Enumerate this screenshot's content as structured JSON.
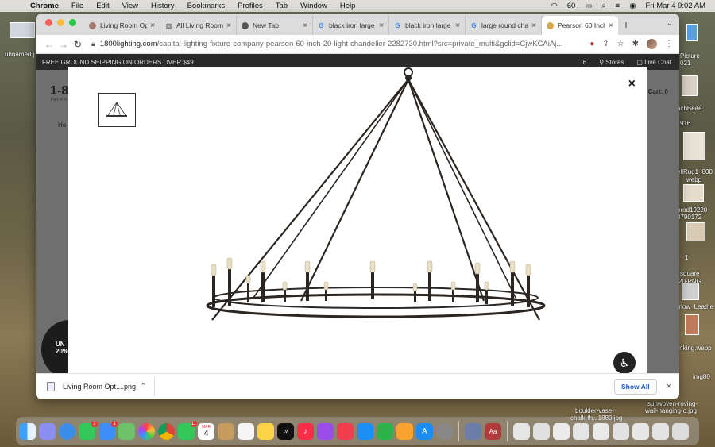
{
  "menubar": {
    "app": "Chrome",
    "items": [
      "File",
      "Edit",
      "View",
      "History",
      "Bookmarks",
      "Profiles",
      "Tab",
      "Window",
      "Help"
    ],
    "battery": "60",
    "clock": "Fri Mar 4  9:02 AM"
  },
  "desktop": {
    "left_label": "unnamed.j",
    "right_items": [
      "Picture",
      "021",
      "acbBeae",
      "916",
      "ellRug1_800",
      "webp",
      "prod19220",
      "8790172",
      "1",
      "square",
      "20-PNG",
      "arlow_Leathe",
      "ranking.webp",
      "img80",
      "boulder-vase-",
      "chalk-th...1880.jpg",
      "sunwoven-roving-",
      "wall-hanging-o.jpg"
    ]
  },
  "tabs": [
    {
      "title": "Living Room Opt",
      "icon": "avatar-favicon"
    },
    {
      "title": "All Living Room",
      "icon": "bookmark-favicon"
    },
    {
      "title": "New Tab",
      "icon": "chrome-favicon"
    },
    {
      "title": "black iron large",
      "icon": "google-favicon"
    },
    {
      "title": "black iron large",
      "icon": "google-favicon"
    },
    {
      "title": "large round cha",
      "icon": "google-favicon"
    },
    {
      "title": "Pearson 60 Inch",
      "icon": "1800lighting-favicon",
      "active": true
    }
  ],
  "address": {
    "host": "1800lighting.com",
    "path": "/capital-lighting-fixture-company-pearson-60-inch-20-light-chandelier-2282730.html?src=private_multi&gclid=CjwKCAiAj..."
  },
  "page": {
    "ship_banner": "FREE GROUND SHIPPING ON ORDERS OVER $49",
    "ship_right_num": "6",
    "stores": "Stores",
    "live_chat": "Live Chat",
    "logo": "1-8",
    "logo_sub": "Part of th",
    "cart": "Cart: 0",
    "breadcrumb": "Ho",
    "promo_line1": "UN",
    "promo_line2": "20%"
  },
  "modal": {
    "close": "×"
  },
  "download": {
    "file": "Living Room Opt....png",
    "show_all": "Show All"
  },
  "dock": {
    "calendar_month": "MAR",
    "calendar_day": "4",
    "badges": {
      "messages": "2",
      "mail": "1",
      "facetime": "11"
    },
    "tv_label": "tv"
  }
}
